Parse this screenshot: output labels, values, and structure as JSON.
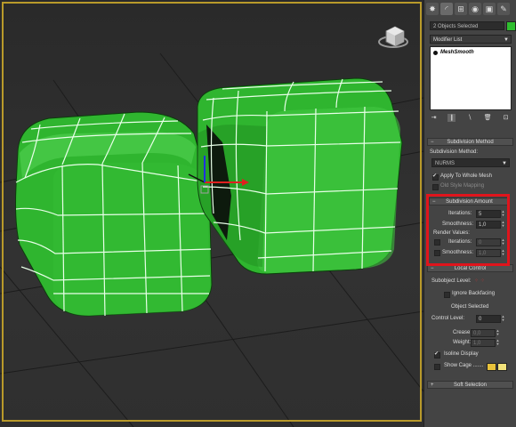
{
  "panel": {
    "selection_field": "2 Objects Selected",
    "selection_color": "#2fbf2f",
    "modifier_list_label": "Modifier List",
    "stack_items": [
      {
        "label": "MeshSmooth"
      }
    ],
    "tab_icons": [
      "sphere-icon",
      "modify-icon",
      "hierarchy-icon",
      "motion-icon",
      "display-icon",
      "utilities-icon"
    ]
  },
  "subdivision_method": {
    "title": "Subdivision Method",
    "method_label": "Subdivision Method:",
    "method_value": "NURMS",
    "apply_whole_mesh": "Apply To Whole Mesh",
    "apply_whole_mesh_checked": true,
    "old_style_mapping": "Old Style Mapping",
    "old_style_mapping_checked": false
  },
  "subdivision_amount": {
    "title": "Subdivision Amount",
    "iterations_label": "Iterations:",
    "iterations_value": "5",
    "smoothness_label": "Smoothness:",
    "smoothness_value": "1,0",
    "render_values_label": "Render Values:",
    "render_iterations_label": "Iterations:",
    "render_iterations_value": "0",
    "render_smoothness_label": "Smoothness:",
    "render_smoothness_value": "1,0"
  },
  "local_control": {
    "title": "Local Control",
    "subobject_level_label": "Subobject Level:",
    "ignore_backfacing": "Ignore Backfacing",
    "object_selected": "Object Selected",
    "control_level_label": "Control Level:",
    "control_level_value": "0",
    "crease_label": "Crease:",
    "crease_value": "0,0",
    "weight_label": "Weight:",
    "weight_value": "1,0",
    "isoline_display": "Isoline Display",
    "isoline_checked": true,
    "show_cage": "Show Cage .......",
    "show_cage_checked": false,
    "cage_color_1": "#e8c23a",
    "cage_color_2": "#f2e27a"
  },
  "soft_selection": {
    "title": "Soft Selection"
  },
  "colors": {
    "highlight": "#e0141c",
    "viewport_border": "#b99a2a",
    "mesh_green": "#2fb52f"
  }
}
